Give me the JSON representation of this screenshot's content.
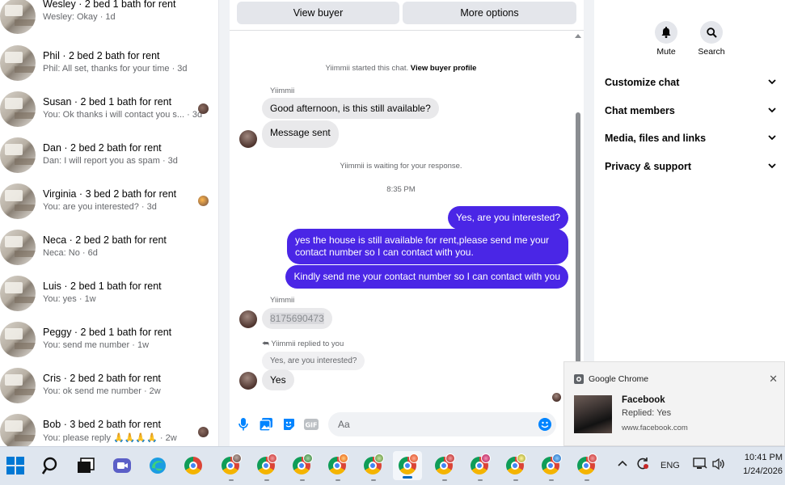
{
  "conversations": [
    {
      "title": "Wesley · 2 bed 1 bath for rent",
      "preview": "Wesley: Okay · 1d",
      "seen": false
    },
    {
      "title": "Phil · 2 bed 2 bath for rent",
      "preview": "Phil: All set, thanks for your time · 3d",
      "seen": false
    },
    {
      "title": "Susan · 2 bed 1 bath for rent",
      "preview": "You: Ok thanks i will contact you s... · 3d",
      "seen": true
    },
    {
      "title": "Dan · 2 bed 2 bath for rent",
      "preview": "Dan: I will report you as spam · 3d",
      "seen": false
    },
    {
      "title": "Virginia · 3 bed 2 bath for rent",
      "preview": "You: are you interested? · 3d",
      "seen": true
    },
    {
      "title": "Neca · 2 bed 2 bath for rent",
      "preview": "Neca: No · 6d",
      "seen": false
    },
    {
      "title": "Luis · 2 bed 1 bath for rent",
      "preview": "You: yes · 1w",
      "seen": false
    },
    {
      "title": "Peggy · 2 bed 1 bath for rent",
      "preview": "You: send me number · 1w",
      "seen": false
    },
    {
      "title": "Cris · 2 bed 2 bath for rent",
      "preview": "You: ok send me number · 2w",
      "seen": false
    },
    {
      "title": "Bob · 3 bed 2 bath for rent",
      "preview": "You: please reply 🙏🙏🙏🙏 · 2w",
      "seen": true
    }
  ],
  "chat": {
    "view_buyer": "View buyer",
    "more_options": "More options",
    "started_note": "Yiimmii started this chat.",
    "view_profile": "View buyer profile",
    "sender_name": "Yiimmii",
    "msg1": "Good afternoon, is this still available?",
    "msg2": "Message sent",
    "waiting_note": "Yiimmii is waiting for your response.",
    "time": "8:35 PM",
    "out1": "Yes, are you interested?",
    "out2_line1": "yes the house is still available for rent,please send me your",
    "out2_line2": "contact number so I can contact with you.",
    "out3": "Kindly send me your contact number so I can contact with you",
    "sender_name2": "Yiimmii",
    "phone": "8175690473",
    "replied_note": "Yiimmii replied to you",
    "quoted": "Yes, are you interested?",
    "reply": "Yes",
    "input_placeholder": "Aa"
  },
  "info": {
    "mute": "Mute",
    "search": "Search",
    "sections": [
      "Customize chat",
      "Chat members",
      "Media, files and links",
      "Privacy & support"
    ]
  },
  "notification": {
    "app": "Google Chrome",
    "title": "Facebook",
    "body": "Replied: Yes",
    "site": "www.facebook.com"
  },
  "taskbar": {
    "lang": "ENG",
    "time": "10:41 PM",
    "date": "1/24/2026"
  },
  "colors": {
    "outgoing_bubble": "#4a26e6",
    "incoming_bubble": "#e9e9eb",
    "accent": "#0084ff"
  }
}
